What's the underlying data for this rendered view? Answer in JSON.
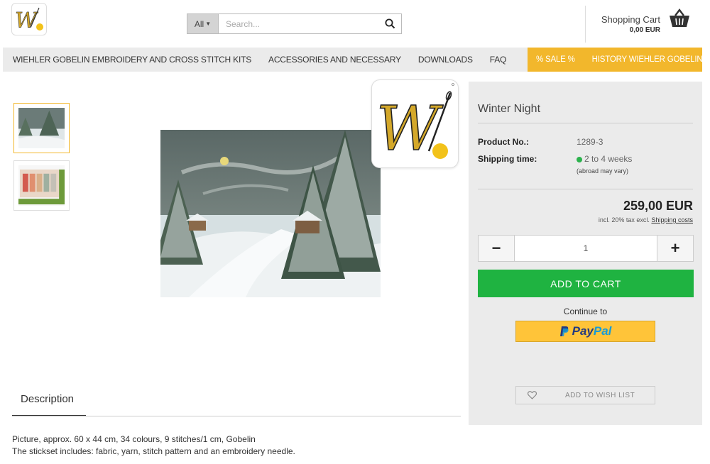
{
  "header": {
    "logo_alt": "W. logo",
    "search": {
      "category": "All",
      "placeholder": "Search..."
    },
    "cart": {
      "title": "Shopping Cart",
      "total": "0,00 EUR"
    }
  },
  "nav": {
    "items": [
      "WIEHLER GOBELIN EMBROIDERY AND CROSS STITCH KITS",
      "ACCESSORIES AND NECESSARY",
      "DOWNLOADS",
      "FAQ"
    ],
    "highlight": [
      "% SALE %",
      "HISTORY WIEHLER GOBELIN"
    ],
    "accent": "#f2b72c"
  },
  "product": {
    "title": "Winter Night",
    "product_no_label": "Product No.:",
    "product_no": "1289-3",
    "shipping_label": "Shipping time:",
    "shipping_value": "2 to 4 weeks",
    "shipping_note": "(abroad may vary)",
    "price": "259,00 EUR",
    "tax_prefix": "incl. 20% tax excl.",
    "tax_link": "Shipping costs",
    "quantity": "1",
    "add_to_cart": "ADD TO CART",
    "continue_to": "Continue to",
    "paypal_p": "Pay",
    "paypal_pal": "Pal",
    "wish_list": "ADD TO WISH LIST",
    "colors": {
      "add_to_cart": "#1fb341",
      "paypal": "#ffc439",
      "stock_dot": "#2bb24c"
    }
  },
  "description": {
    "tab": "Description",
    "line1": "Picture, approx. 60 x 44 cm, 34 colours, 9 stitches/1 cm, Gobelin",
    "line2": "The stickset includes: fabric, yarn, stitch pattern and an embroidery needle."
  }
}
